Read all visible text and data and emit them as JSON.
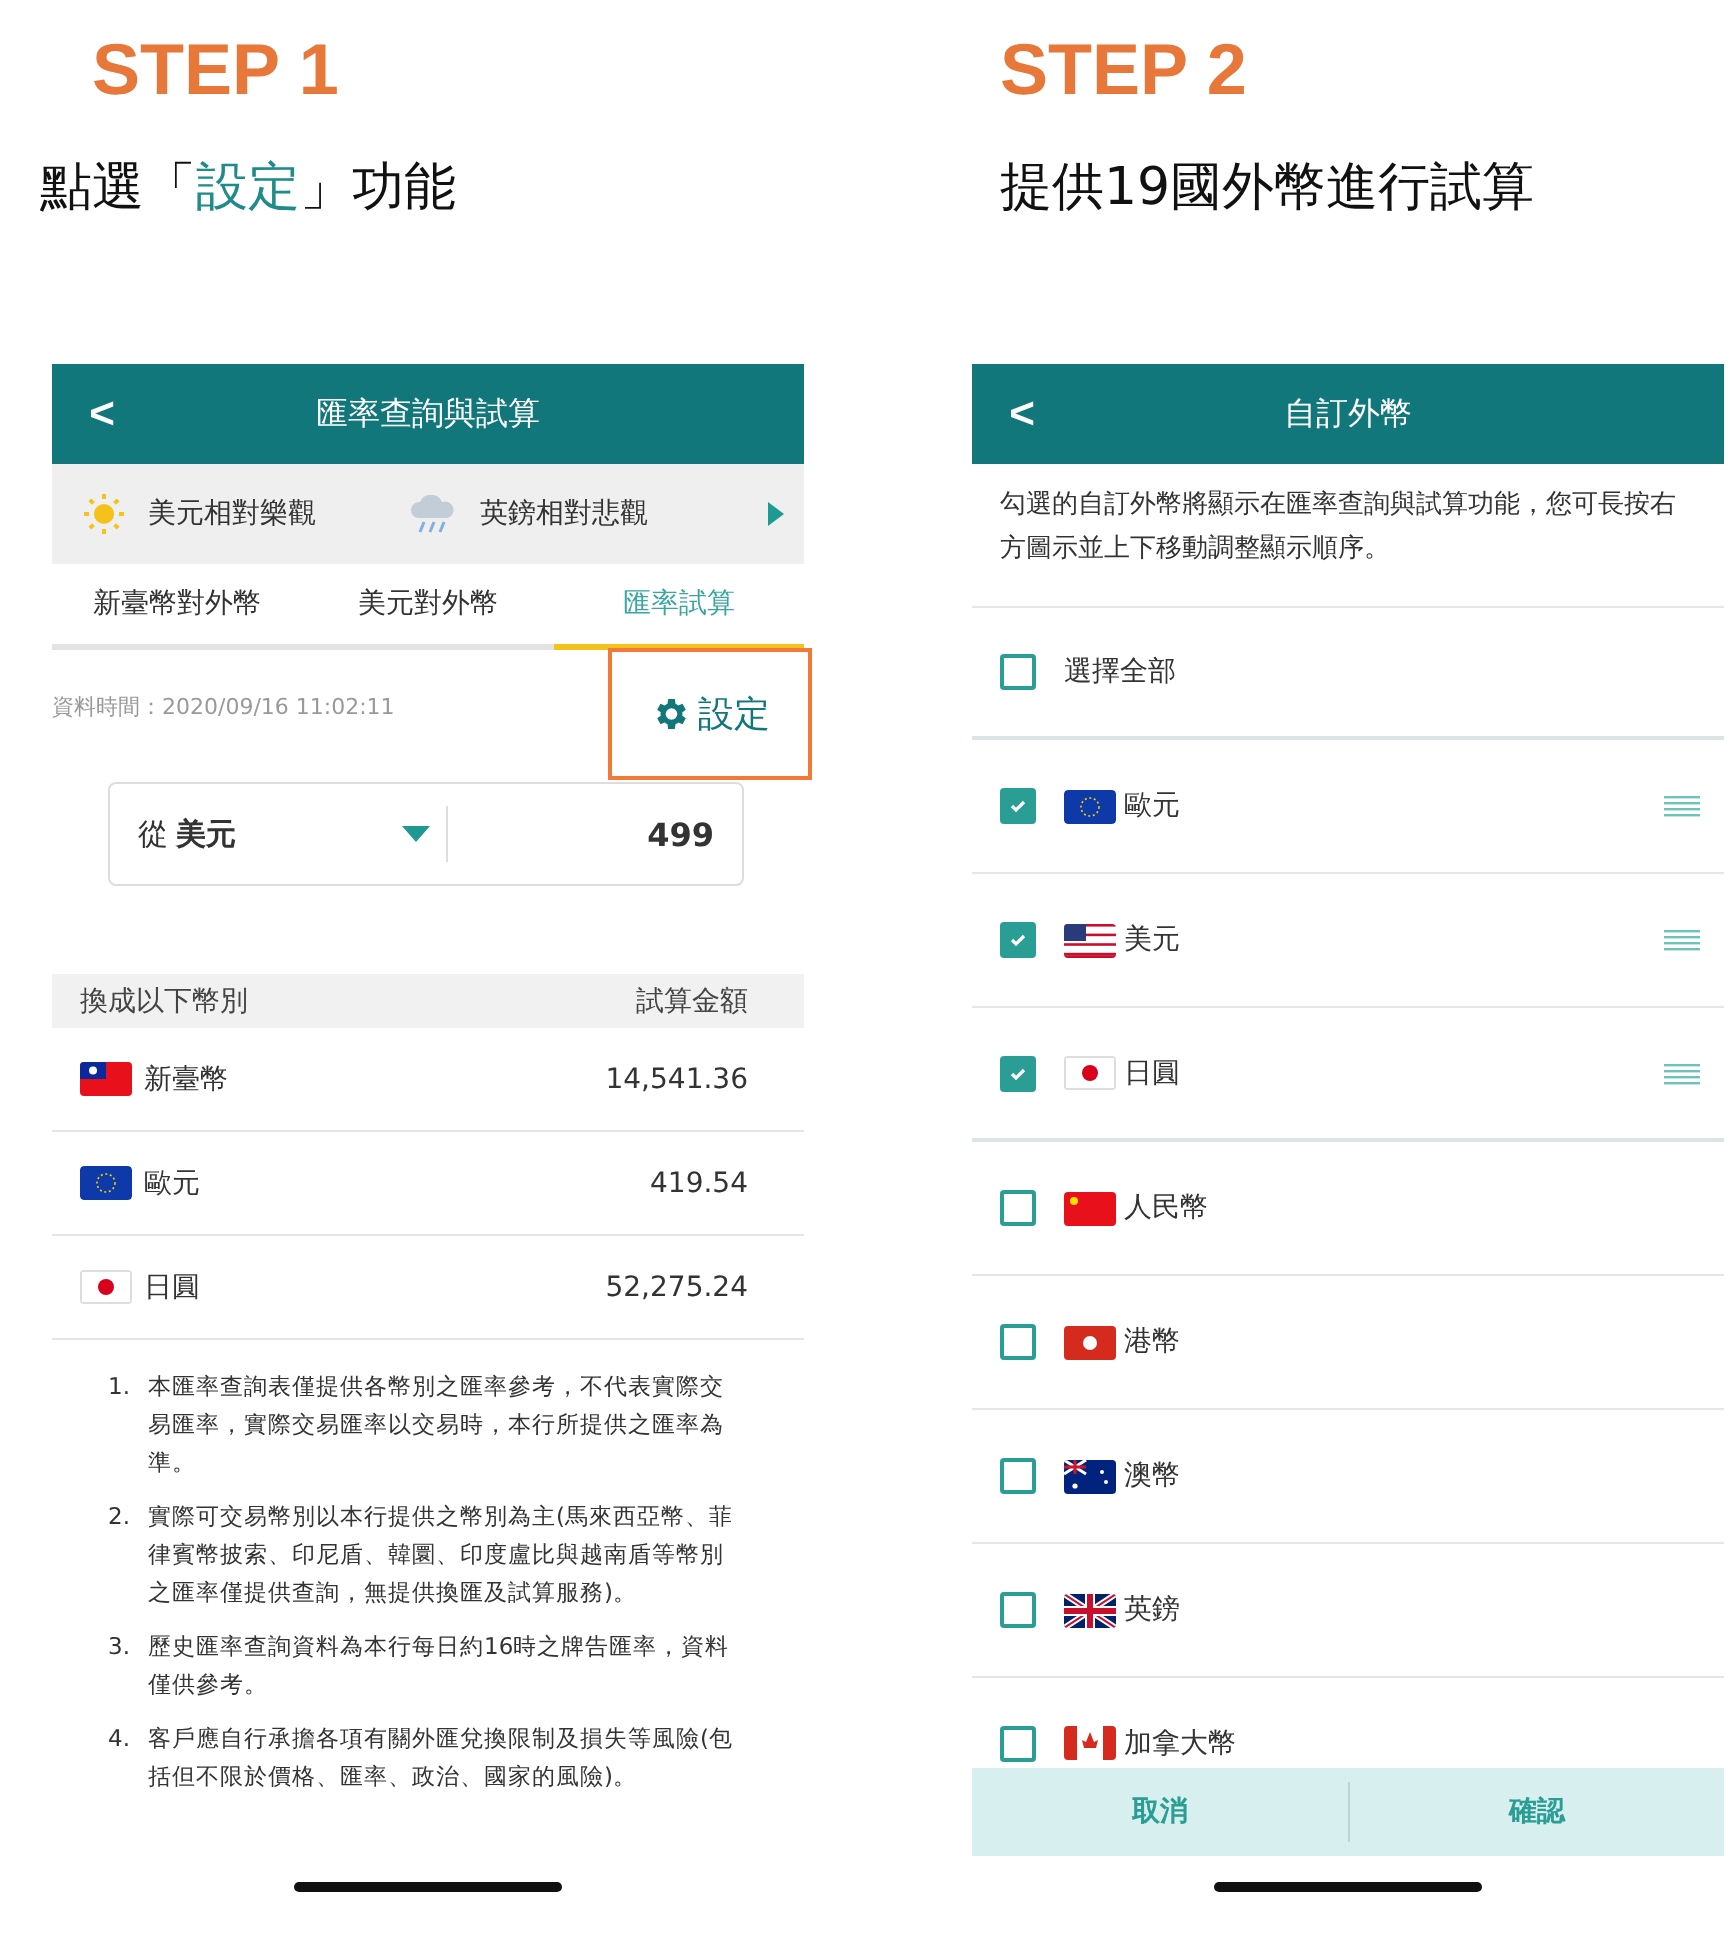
{
  "steps": [
    {
      "step_label": "STEP 1",
      "subtitle": [
        {
          "text": "點選「",
          "highlight": false
        },
        {
          "text": "設定",
          "highlight": true
        },
        {
          "text": "」功能",
          "highlight": false
        }
      ],
      "screen": {
        "kind": "converter",
        "title": "匯率查詢與試算",
        "back": "<",
        "ticker": [
          {
            "kind": "sunny",
            "text": "美元相對樂觀"
          },
          {
            "kind": "rainy",
            "text": "英鎊相對悲觀"
          }
        ],
        "tabs": [
          {
            "label": "新臺幣對外幣",
            "selected": false
          },
          {
            "label": "美元對外幣",
            "selected": false
          },
          {
            "label": "匯率試算",
            "selected": true
          }
        ],
        "data_time": "資料時間：2020/09/16 11:02:11",
        "settings_button": {
          "label": "設定",
          "highlighted": true
        },
        "from": {
          "prefix": "從",
          "currency": "美元",
          "amount": "499"
        },
        "table": {
          "columns": [
            "換成以下幣別",
            "試算金額"
          ],
          "rows": [
            {
              "kind": "tw",
              "currency": "新臺幣",
              "amount": "14,541.36"
            },
            {
              "kind": "eu",
              "currency": "歐元",
              "amount": "419.54"
            },
            {
              "kind": "jp",
              "currency": "日圓",
              "amount": "52,275.24"
            }
          ]
        },
        "notes": [
          {
            "number": "1.",
            "text": "本匯率查詢表僅提供各幣別之匯率參考，不代表實際交易匯率，實際交易匯率以交易時，本行所提供之匯率為準。"
          },
          {
            "number": "2.",
            "text": "實際可交易幣別以本行提供之幣別為主(馬來西亞幣、菲律賓幣披索、印尼盾、韓圜、印度盧比與越南盾等幣別之匯率僅提供查詢，無提供換匯及試算服務)。"
          },
          {
            "number": "3.",
            "text": "歷史匯率查詢資料為本行每日約16時之牌告匯率，資料僅供參考。"
          },
          {
            "number": "4.",
            "text": "客戶應自行承擔各項有關外匯兌換限制及損失等風險(包括但不限於價格、匯率、政治、國家的風險)。"
          }
        ]
      }
    },
    {
      "step_label": "STEP 2",
      "subtitle": [
        {
          "text": "提供19國外幣進行試算",
          "highlight": false
        }
      ],
      "screen": {
        "kind": "picker",
        "title": "自訂外幣",
        "back": "<",
        "description": "勾選的自訂外幣將顯示在匯率查詢與試算功能，您可長按右方圖示並上下移動調整顯示順序。",
        "select_all": {
          "label": "選擇全部",
          "checked": false
        },
        "currencies": [
          {
            "kind": "eu",
            "label": "歐元",
            "checked": true
          },
          {
            "kind": "us",
            "label": "美元",
            "checked": true
          },
          {
            "kind": "jp",
            "label": "日圓",
            "checked": true
          },
          {
            "kind": "cn",
            "label": "人民幣",
            "checked": false
          },
          {
            "kind": "hk",
            "label": "港幣",
            "checked": false
          },
          {
            "kind": "au",
            "label": "澳幣",
            "checked": false
          },
          {
            "kind": "gb",
            "label": "英鎊",
            "checked": false
          },
          {
            "kind": "ca",
            "label": "加拿大幣",
            "checked": false
          }
        ],
        "buttons": [
          "取消",
          "確認"
        ]
      }
    }
  ]
}
